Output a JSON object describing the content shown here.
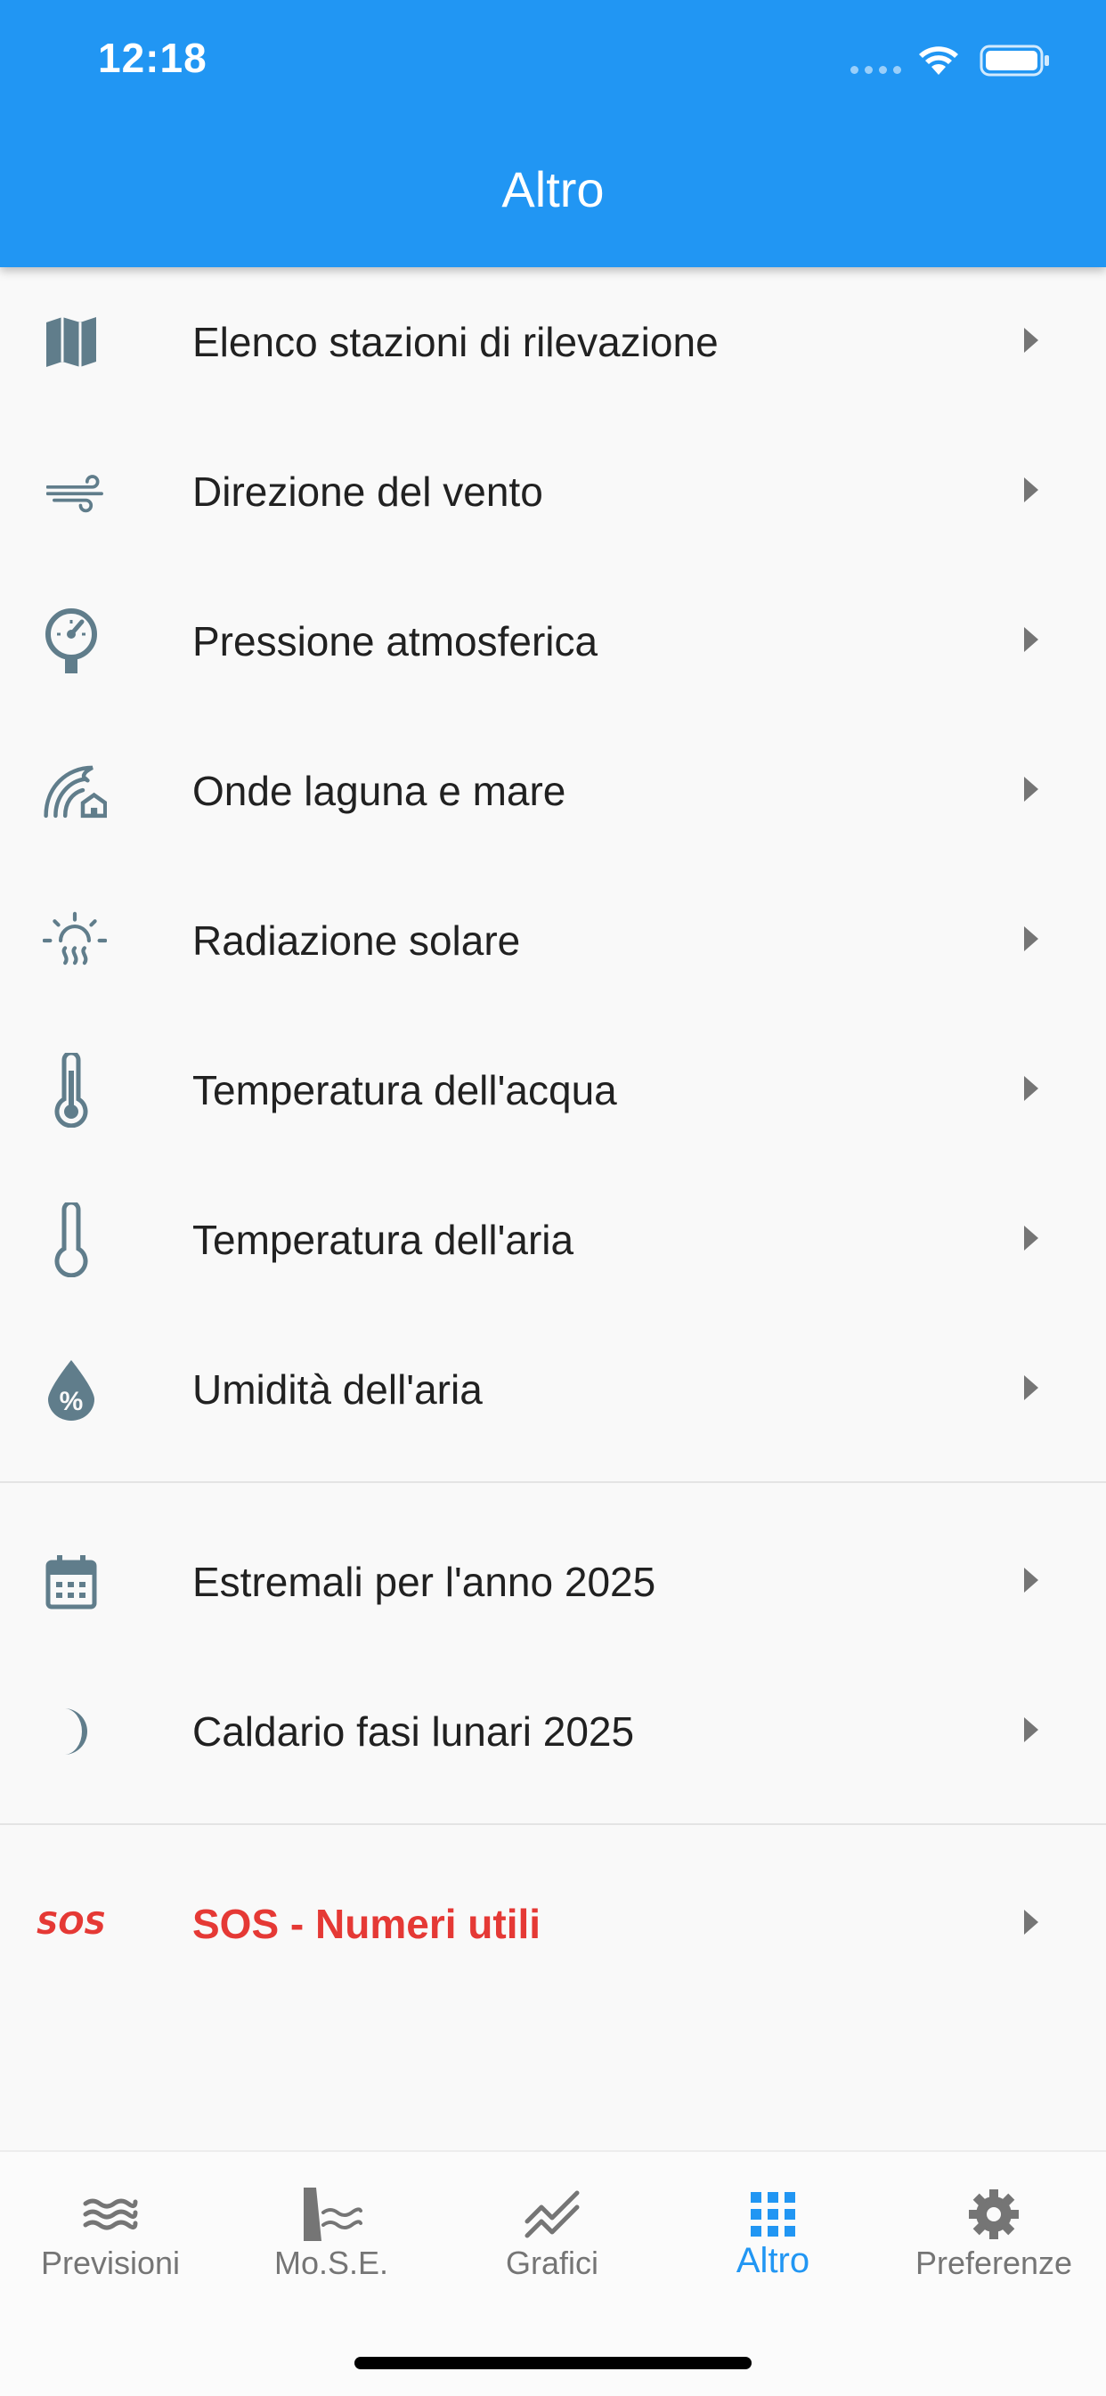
{
  "status_bar": {
    "time": "12:18"
  },
  "app_bar": {
    "title": "Altro"
  },
  "menu": {
    "group1": [
      {
        "label": "Elenco stazioni di rilevazione",
        "icon": "map-icon"
      },
      {
        "label": "Direzione del vento",
        "icon": "wind-icon"
      },
      {
        "label": "Pressione atmosferica",
        "icon": "barometer-icon"
      },
      {
        "label": "Onde laguna e mare",
        "icon": "wave-house-icon"
      },
      {
        "label": "Radiazione solare",
        "icon": "sun-heat-icon"
      },
      {
        "label": "Temperatura dell'acqua",
        "icon": "thermometer-water-icon"
      },
      {
        "label": "Temperatura dell'aria",
        "icon": "thermometer-air-icon"
      },
      {
        "label": "Umidità dell'aria",
        "icon": "humidity-drop-icon"
      }
    ],
    "group2": [
      {
        "label": "Estremali per l'anno 2025",
        "icon": "calendar-icon"
      },
      {
        "label": "Caldario fasi lunari 2025",
        "icon": "moon-icon"
      }
    ],
    "sos": {
      "label": "SOS - Numeri utili",
      "icon_text": "SOS",
      "icon": "sos-icon"
    }
  },
  "bottom_nav": [
    {
      "label": "Previsioni",
      "icon": "waves-icon",
      "active": false
    },
    {
      "label": "Mo.S.E.",
      "icon": "mose-barrier-icon",
      "active": false
    },
    {
      "label": "Grafici",
      "icon": "chart-lines-icon",
      "active": false
    },
    {
      "label": "Altro",
      "icon": "grid-icon",
      "active": true
    },
    {
      "label": "Preferenze",
      "icon": "gear-icon",
      "active": false
    }
  ],
  "colors": {
    "primary": "#2196f3",
    "icon_gray": "#607d8b",
    "sos_red": "#e53935",
    "text": "#212121"
  }
}
